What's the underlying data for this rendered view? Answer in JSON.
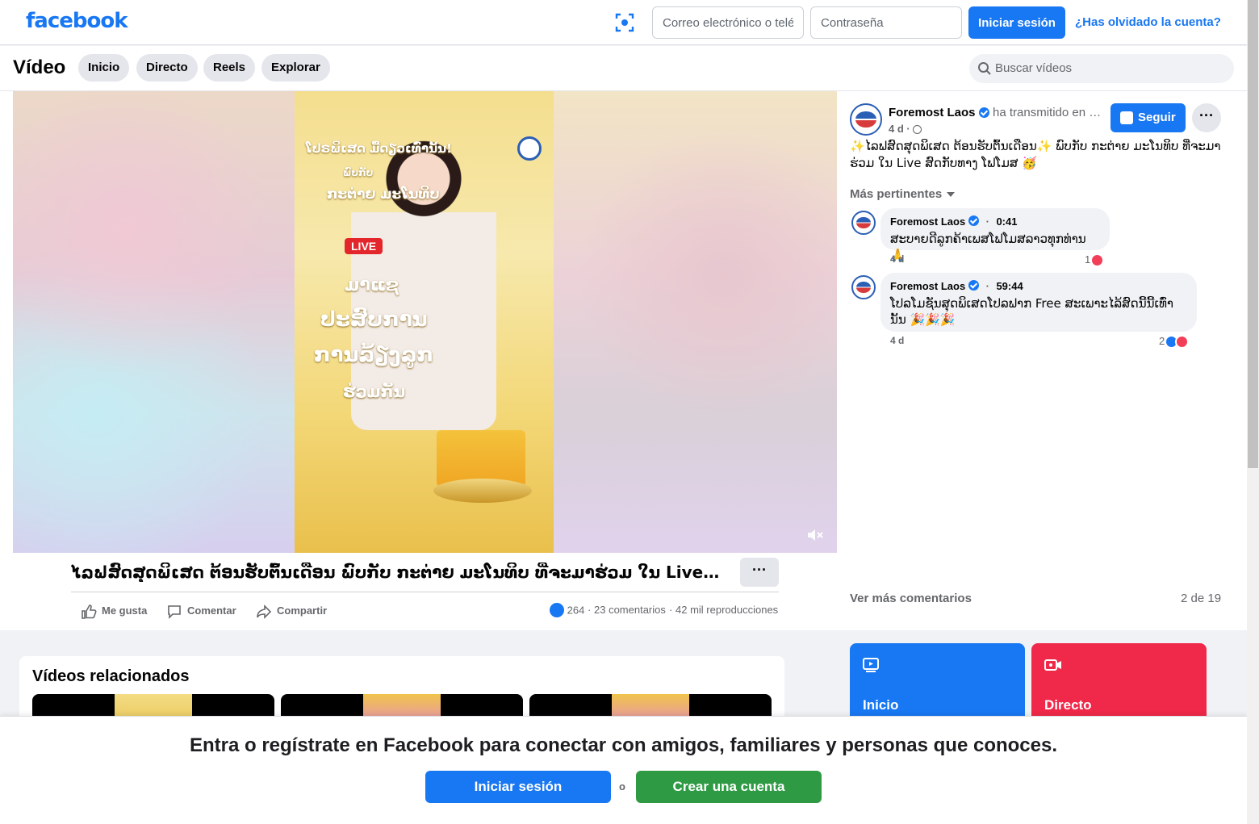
{
  "topbar": {
    "logo": "facebook",
    "email_placeholder": "Correo electrónico o teléfono",
    "password_placeholder": "Contraseña",
    "login_label": "Iniciar sesión",
    "forgot_label": "¿Has olvidado la cuenta?"
  },
  "video_header": {
    "title": "Vídeo",
    "tabs": [
      {
        "label": "Inicio"
      },
      {
        "label": "Directo"
      },
      {
        "label": "Reels"
      },
      {
        "label": "Explorar"
      }
    ],
    "search_placeholder": "Buscar vídeos"
  },
  "video": {
    "poster_lines": [
      "ໂປຣພິເສດ ມື້ດຽວເທົ່ານັ້ນ!",
      "ພົບກັບ",
      "ກະຕ່າຍ ມະໂນທິບ",
      "ມາແຊ",
      "ປະສົບການ",
      "ການລ້ຽງລູກ",
      "ຮ່ວມກັນ"
    ],
    "poster_live": "LIVE"
  },
  "post": {
    "title": "ໄລຟສົດສຸດພິເສດ ຕ້ອນຮັບຕົ້ນເດືອນ ພົບກັບ ກະຕ່າຍ ມະໂນທິບ ທີ່ຈະມາຮ່ວມ ໃນ Live ສົດກັບທາງ...",
    "actions": {
      "like": "Me gusta",
      "comment": "Comentar",
      "share": "Compartir"
    },
    "reactions_count": "264",
    "comments_count": "23 comentarios",
    "views": "42 mil reproducciones"
  },
  "page": {
    "name": "Foremost Laos",
    "broadcast_text": "ha transmitido en directo.",
    "age": "4 d",
    "follow_label": "Seguir",
    "description": "✨ໄລຟສົດສຸດພິເສດ ຕ້ອນຮັບຕົ້ນເດືອນ✨ ພົບກັບ ກະຕ່າຍ ມະໂນທິບ ທີ່ຈະມາຮ່ວມ ໃນ Live ສົດກັບທາງ ໂຟໂມສ 🥳"
  },
  "comments": {
    "filter_label": "Más pertinentes",
    "items": [
      {
        "author": "Foremost Laos",
        "timestamp": "0:41",
        "text": "ສະບາຍດີລູກຄ້າເພສໂຟໂມສລາວທຸກທ່ານ🙏",
        "age": "4 d",
        "reactions": "1"
      },
      {
        "author": "Foremost Laos",
        "timestamp": "59:44",
        "text": "ໂປລໂມຊັນສຸດພິເສດໂປລຟາກ Free ສະເພາະໄລ້ສົດນີ້ນີ້ເທົ່ານັ້ນ 🎉🎉🎉",
        "age": "4 d",
        "reactions": "2"
      }
    ],
    "see_more": "Ver más comentarios",
    "count": "2 de 19"
  },
  "related": {
    "title": "Vídeos relacionados"
  },
  "nav_tiles": [
    {
      "label": "Inicio",
      "color": "#1877f2"
    },
    {
      "label": "Directo",
      "color": "#f02849"
    }
  ],
  "banner": {
    "text": "Entra o regístrate en Facebook para conectar con amigos, familiares y personas que conoces.",
    "login_label": "Iniciar sesión",
    "or_label": "o",
    "create_label": "Crear una cuenta"
  }
}
